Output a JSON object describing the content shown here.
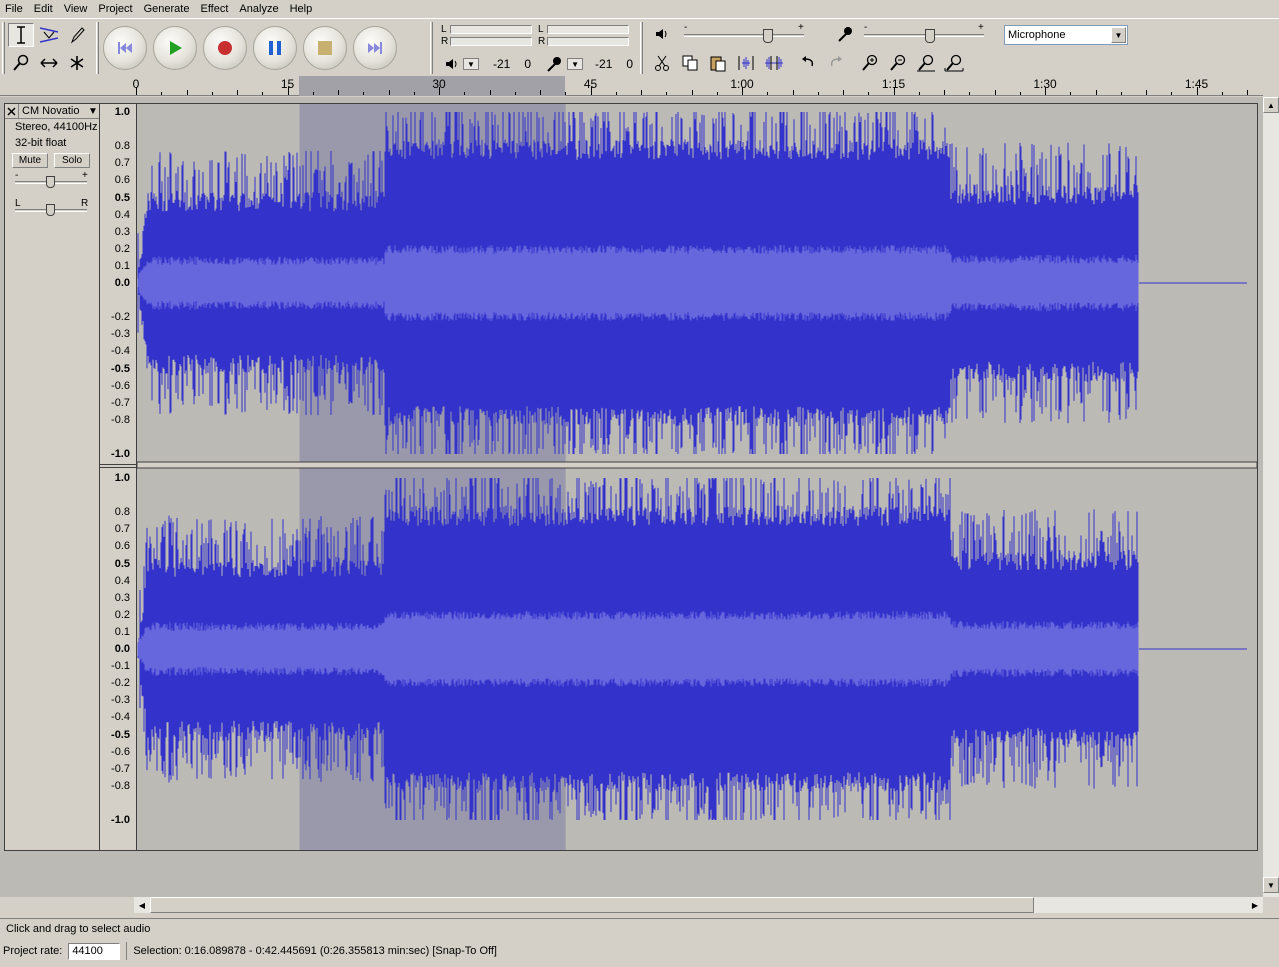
{
  "menu": [
    "File",
    "Edit",
    "View",
    "Project",
    "Generate",
    "Effect",
    "Analyze",
    "Help"
  ],
  "tools": {
    "icons": [
      "ibeam-select-icon",
      "envelope-icon",
      "pencil-icon",
      "zoom-icon",
      "timeshift-icon",
      "multi-tool-icon"
    ],
    "glyphs": [
      "I",
      "⌛",
      "✎",
      "⚲",
      "↔",
      "✱"
    ]
  },
  "transport": [
    "skip-start",
    "play",
    "record",
    "pause",
    "stop",
    "skip-end"
  ],
  "meters": {
    "play_label_l": "L",
    "play_label_r": "R",
    "rec_label_l": "L",
    "rec_label_r": "R",
    "play_db": "-21",
    "play_zero": "0",
    "rec_db": "-21",
    "rec_zero": "0"
  },
  "mixer": {
    "minus": "-",
    "plus": "+",
    "input_source": "Microphone",
    "output_level": 0.7,
    "input_level": 0.55
  },
  "ruler": {
    "labels": [
      "0",
      "15",
      "30",
      "45",
      "1:00",
      "1:15",
      "1:30",
      "1:45"
    ],
    "total_seconds": 111,
    "selection_start": 16.089878,
    "selection_end": 42.445691
  },
  "track": {
    "name": "CM Novatio",
    "format": "Stereo, 44100Hz",
    "sample": "32-bit float",
    "mute": "Mute",
    "solo": "Solo",
    "gain_minus": "-",
    "gain_plus": "+",
    "pan_l": "L",
    "pan_r": "R",
    "audio_end_seconds": 99.2
  },
  "vruler_labels": [
    "1.0",
    "0.8",
    "0.7",
    "0.6",
    "0.5",
    "0.4",
    "0.3",
    "0.2",
    "0.1",
    "0.0",
    "-0.2",
    "-0.3",
    "-0.4",
    "-0.5",
    "-0.6",
    "-0.7",
    "-0.8",
    "-1.0"
  ],
  "vruler2_labels": [
    "1.0",
    "0.8",
    "0.7",
    "0.6",
    "0.5",
    "0.4",
    "0.3",
    "0.2",
    "0.1",
    "0.0",
    "-0.1",
    "-0.2",
    "-0.3",
    "-0.4",
    "-0.5",
    "-0.6",
    "-0.7",
    "-0.8",
    "-1.0"
  ],
  "status": {
    "hint": "Click and drag to select audio",
    "rate_label": "Project rate:",
    "rate_value": "44100",
    "selection": "Selection: 0:16.089878 - 0:42.445691 (0:26.355813 min:sec)  [Snap-To Off]"
  },
  "colors": {
    "wave_dark": "#3333cc",
    "wave_light": "#6666dd",
    "selection": "#9a99ac",
    "background": "#bcbab4"
  }
}
